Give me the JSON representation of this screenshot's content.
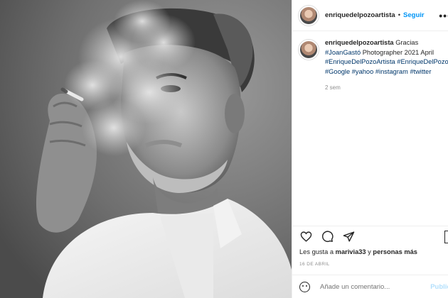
{
  "header": {
    "username": "enriquedelpozoartista",
    "separator": "•",
    "follow_label": "Seguir",
    "more_label": "•••"
  },
  "caption": {
    "username": "enriquedelpozoartista",
    "text_before": "Gracias",
    "tag1": "#JoanGastó",
    "text_middle": "Photographer 2021 April",
    "tag2": "#EnriqueDelPozoArtista",
    "tag3": "#EnriqueDelPozo",
    "tag4": "#Google",
    "tag5": "#yahoo",
    "tag6": "#instagram",
    "tag7": "#twitter",
    "time_ago": "2 sem"
  },
  "likes": {
    "prefix": "Les gusta a",
    "user": "marivia33",
    "connector": "y",
    "others": "personas más"
  },
  "post_date": "16 DE ABRIL",
  "comment": {
    "placeholder": "Añade un comentario...",
    "publish_label": "Publica"
  },
  "icons": {
    "like": "heart-icon",
    "comment": "comment-icon",
    "share": "paper-plane-icon",
    "save": "bookmark-icon",
    "emoji": "smiley-icon"
  },
  "colors": {
    "accent": "#0095f6",
    "hashtag": "#00376b",
    "muted": "#8e8e8e"
  }
}
